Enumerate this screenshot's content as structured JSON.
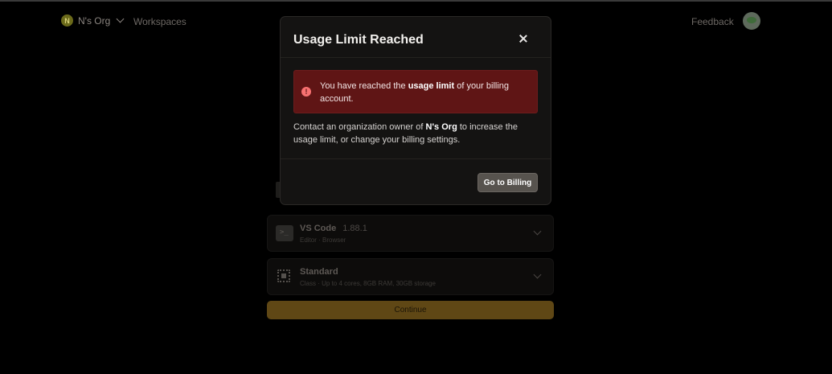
{
  "nav": {
    "org_initial": "N",
    "org_name": "N's Org",
    "workspaces_label": "Workspaces",
    "feedback_label": "Feedback"
  },
  "background": {
    "editor_card": {
      "title": "VS Code",
      "version": "1.88.1",
      "subtitle": "Editor · Browser"
    },
    "class_card": {
      "title": "Standard",
      "subtitle": "Class · Up to 4 cores, 8GB RAM, 30GB storage"
    },
    "continue_label": "Continue"
  },
  "modal": {
    "title": "Usage Limit Reached",
    "alert": {
      "prefix": "You have reached the ",
      "bold": "usage limit",
      "suffix": " of your billing account."
    },
    "body": {
      "prefix": "Contact an organization owner of ",
      "org": "N's Org",
      "suffix": " to increase the usage limit, or change your billing settings."
    },
    "billing_button": "Go to Billing"
  },
  "colors": {
    "alert_bg": "#5f1515",
    "continue_bg": "#5f4715",
    "modal_bg": "#141312"
  }
}
